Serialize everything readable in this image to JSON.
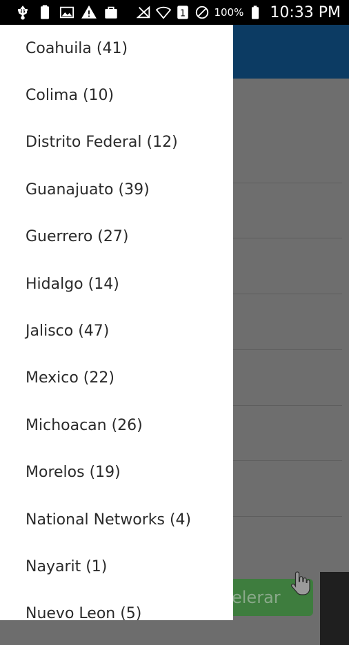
{
  "status_bar": {
    "battery_percent": "100%",
    "time": "10:33 PM",
    "icons": [
      "usb-icon",
      "battery-box-icon",
      "image-icon",
      "warning-icon",
      "bag-icon",
      "signal-off-icon",
      "wifi-icon",
      "sim-1-icon",
      "do-not-disturb-icon",
      "battery-icon"
    ]
  },
  "background_app": {
    "button_label": "elerar",
    "header_color": "#0c3b63",
    "button_color": "#3e7d3e"
  },
  "drawer": {
    "items": [
      {
        "label": "Coahuila (41)"
      },
      {
        "label": "Colima (10)"
      },
      {
        "label": "Distrito Federal (12)"
      },
      {
        "label": "Guanajuato (39)"
      },
      {
        "label": "Guerrero (27)"
      },
      {
        "label": "Hidalgo (14)"
      },
      {
        "label": "Jalisco (47)"
      },
      {
        "label": "Mexico (22)"
      },
      {
        "label": "Michoacan (26)"
      },
      {
        "label": "Morelos (19)"
      },
      {
        "label": "National Networks (4)"
      },
      {
        "label": "Nayarit (1)"
      },
      {
        "label": "Nuevo Leon (5)"
      }
    ]
  }
}
